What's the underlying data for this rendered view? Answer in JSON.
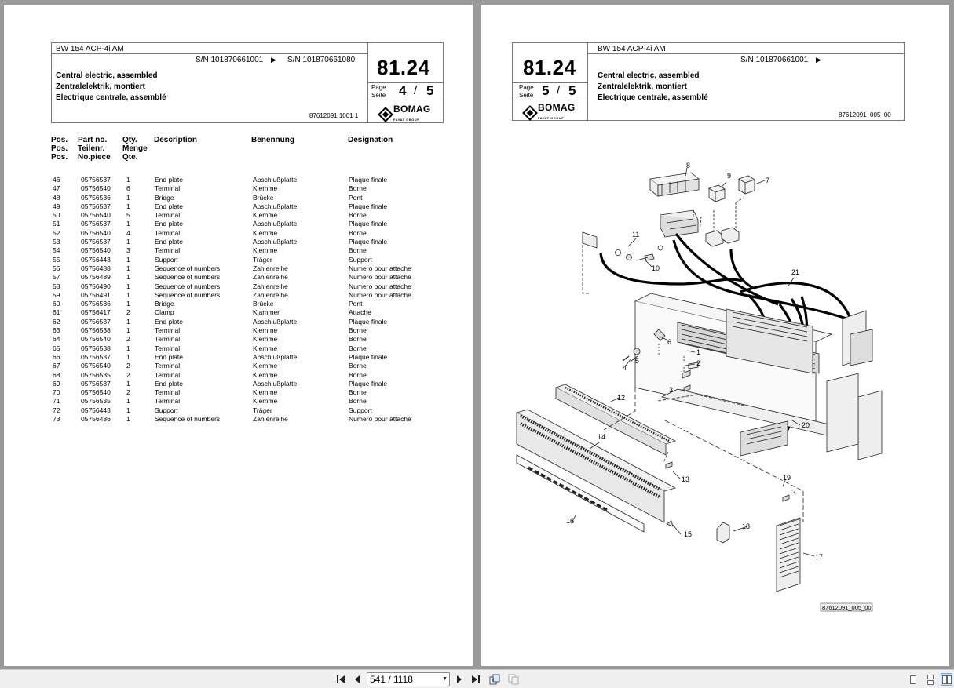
{
  "left_page": {
    "model": "BW 154 ACP-4i AM",
    "sn_from": "S/N 101870661001",
    "sn_to": "S/N 101870661080",
    "title_en": "Central electric, assembled",
    "title_de": "Zentralelektrik, montiert",
    "title_fr": "Electrique centrale, assemblé",
    "group": "81.24",
    "page_label_1": "Page",
    "page_label_2": "Seite",
    "page_current": "4",
    "page_sep": "/",
    "page_total": "5",
    "doc_number": "87612091 1001 1",
    "logo_text": "BOMAG",
    "logo_sub": "FAYAT GROUP",
    "headers": {
      "pos": [
        "Pos.",
        "Pos.",
        "Pos."
      ],
      "part": [
        "Part no.",
        "Teilenr.",
        "No.piece"
      ],
      "qty": [
        "Qty.",
        "Menge",
        "Qte."
      ],
      "description": "Description",
      "benennung": "Benennung",
      "designation": "Designation"
    },
    "rows": [
      [
        "46",
        "05756537",
        "1",
        "End plate",
        "Abschlußplatte",
        "Plaque finale"
      ],
      [
        "47",
        "05756540",
        "6",
        "Terminal",
        "Klemme",
        "Borne"
      ],
      [
        "48",
        "05756536",
        "1",
        "Bridge",
        "Brücke",
        "Pont"
      ],
      [
        "49",
        "05756537",
        "1",
        "End plate",
        "Abschlußplatte",
        "Plaque finale"
      ],
      [
        "50",
        "05756540",
        "5",
        "Terminal",
        "Klemme",
        "Borne"
      ],
      [
        "51",
        "05756537",
        "1",
        "End plate",
        "Abschlußplatte",
        "Plaque finale"
      ],
      [
        "52",
        "05756540",
        "4",
        "Terminal",
        "Klemme",
        "Borne"
      ],
      [
        "53",
        "05756537",
        "1",
        "End plate",
        "Abschlußplatte",
        "Plaque finale"
      ],
      [
        "54",
        "05756540",
        "3",
        "Terminal",
        "Klemme",
        "Borne"
      ],
      [
        "55",
        "05756443",
        "1",
        "Support",
        "Träger",
        "Support"
      ],
      [
        "56",
        "05756488",
        "1",
        "Sequence of numbers",
        "Zahlenreihe",
        "Numero pour attache"
      ],
      [
        "57",
        "05756489",
        "1",
        "Sequence of numbers",
        "Zahlenreihe",
        "Numero pour attache"
      ],
      [
        "58",
        "05756490",
        "1",
        "Sequence of numbers",
        "Zahlenreihe",
        "Numero pour attache"
      ],
      [
        "59",
        "05756491",
        "1",
        "Sequence of numbers",
        "Zahlenreihe",
        "Numero pour attache"
      ],
      [
        "60",
        "05756536",
        "1",
        "Bridge",
        "Brücke",
        "Pont"
      ],
      [
        "61",
        "05756417",
        "2",
        "Clamp",
        "Klammer",
        "Attache"
      ],
      [
        "62",
        "05756537",
        "1",
        "End plate",
        "Abschlußplatte",
        "Plaque finale"
      ],
      [
        "63",
        "05756538",
        "1",
        "Terminal",
        "Klemme",
        "Borne"
      ],
      [
        "64",
        "05756540",
        "2",
        "Terminal",
        "Klemme",
        "Borne"
      ],
      [
        "65",
        "05756538",
        "1",
        "Terminal",
        "Klemme",
        "Borne"
      ],
      [
        "66",
        "05756537",
        "1",
        "End plate",
        "Abschlußplatte",
        "Plaque finale"
      ],
      [
        "67",
        "05756540",
        "2",
        "Terminal",
        "Klemme",
        "Borne"
      ],
      [
        "68",
        "05756535",
        "2",
        "Terminal",
        "Klemme",
        "Borne"
      ],
      [
        "69",
        "05756537",
        "1",
        "End plate",
        "Abschlußplatte",
        "Plaque finale"
      ],
      [
        "70",
        "05756540",
        "2",
        "Terminal",
        "Klemme",
        "Borne"
      ],
      [
        "71",
        "05756535",
        "1",
        "Terminal",
        "Klemme",
        "Borne"
      ],
      [
        "72",
        "05756443",
        "1",
        "Support",
        "Träger",
        "Support"
      ],
      [
        "73",
        "05756486",
        "1",
        "Sequence of numbers",
        "Zahlenreihe",
        "Numero pour attache"
      ]
    ]
  },
  "right_page": {
    "model": "BW 154 ACP-4i AM",
    "sn_from": "S/N 101870661001",
    "title_en": "Central electric, assembled",
    "title_de": "Zentralelektrik, montiert",
    "title_fr": "Electrique centrale, assemblé",
    "group": "81.24",
    "page_label_1": "Page",
    "page_label_2": "Seite",
    "page_current": "5",
    "page_sep": "/",
    "page_total": "5",
    "doc_number": "87612091_005_00",
    "logo_text": "BOMAG",
    "logo_sub": "FAYAT GROUP",
    "diagram_ref": "87612091_005_00",
    "callouts": [
      "8",
      "9",
      "7",
      "11",
      "10",
      "21",
      "6",
      "5",
      "4",
      "1",
      "2",
      "3",
      "12",
      "20",
      "14",
      "13",
      "19",
      "16",
      "18",
      "15",
      "17"
    ]
  },
  "toolbar": {
    "page_field": "541 / 1118",
    "icons": [
      "first-page-icon",
      "prev-page-icon",
      "next-page-icon",
      "last-page-icon",
      "prev-view-icon",
      "next-view-icon",
      "single-page-view-icon",
      "continuous-view-icon",
      "facing-pages-view-icon"
    ]
  }
}
